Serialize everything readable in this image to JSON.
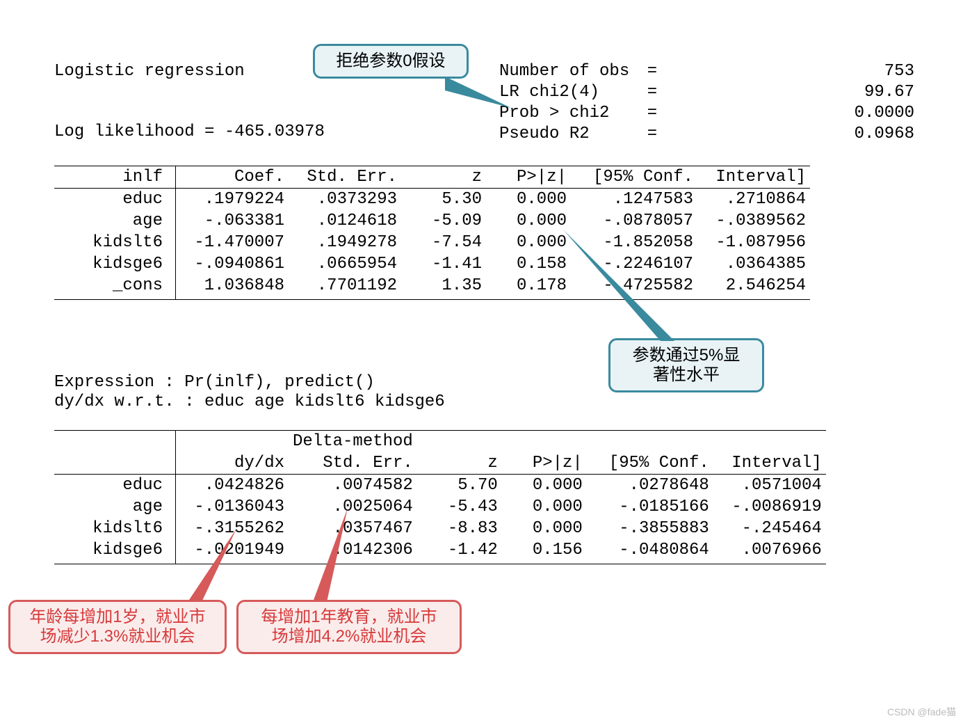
{
  "header": {
    "title": "Logistic regression",
    "loglik": "Log likelihood = -465.03978",
    "stats": [
      {
        "label": "Number of obs",
        "eq": "=",
        "val": "753"
      },
      {
        "label": "LR chi2(4)",
        "eq": "=",
        "val": "99.67"
      },
      {
        "label": "Prob > chi2",
        "eq": "=",
        "val": "0.0000"
      },
      {
        "label": "Pseudo R2",
        "eq": "=",
        "val": "0.0968"
      }
    ]
  },
  "table1": {
    "depvar": "inlf",
    "cols": [
      "Coef.",
      "Std. Err.",
      "z",
      "P>|z|",
      "[95% Conf.",
      "Interval]"
    ],
    "rows": [
      {
        "name": "educ",
        "coef": ".1979224",
        "se": ".0373293",
        "z": "5.30",
        "p": "0.000",
        "ci1": ".1247583",
        "ci2": ".2710864"
      },
      {
        "name": "age",
        "coef": "-.063381",
        "se": ".0124618",
        "z": "-5.09",
        "p": "0.000",
        "ci1": "-.0878057",
        "ci2": "-.0389562"
      },
      {
        "name": "kidslt6",
        "coef": "-1.470007",
        "se": ".1949278",
        "z": "-7.54",
        "p": "0.000",
        "ci1": "-1.852058",
        "ci2": "-1.087956"
      },
      {
        "name": "kidsge6",
        "coef": "-.0940861",
        "se": ".0665954",
        "z": "-1.41",
        "p": "0.158",
        "ci1": "-.2246107",
        "ci2": ".0364385"
      },
      {
        "name": "_cons",
        "coef": "1.036848",
        "se": ".7701192",
        "z": "1.35",
        "p": "0.178",
        "ci1": "-.4725582",
        "ci2": "2.546254"
      }
    ]
  },
  "expression": {
    "line1": "Expression   : Pr(inlf), predict()",
    "line2": "dy/dx w.r.t. : educ age kidslt6 kidsge6"
  },
  "table2": {
    "depvar": "",
    "delta": "Delta-method",
    "cols": [
      "dy/dx",
      "Std. Err.",
      "z",
      "P>|z|",
      "[95% Conf.",
      "Interval]"
    ],
    "rows": [
      {
        "name": "educ",
        "dydx": ".0424826",
        "se": ".0074582",
        "z": "5.70",
        "p": "0.000",
        "ci1": ".0278648",
        "ci2": ".0571004"
      },
      {
        "name": "age",
        "dydx": "-.0136043",
        "se": ".0025064",
        "z": "-5.43",
        "p": "0.000",
        "ci1": "-.0185166",
        "ci2": "-.0086919"
      },
      {
        "name": "kidslt6",
        "dydx": "-.3155262",
        "se": ".0357467",
        "z": "-8.83",
        "p": "0.000",
        "ci1": "-.3855883",
        "ci2": "-.245464"
      },
      {
        "name": "kidsge6",
        "dydx": "-.0201949",
        "se": ".0142306",
        "z": "-1.42",
        "p": "0.156",
        "ci1": "-.0480864",
        "ci2": ".0076966"
      }
    ]
  },
  "callouts": {
    "c1": "拒绝参数0假设",
    "c2": "参数通过5%显\n著性水平",
    "c3": "年龄每增加1岁，就业市\n场减少1.3%就业机会",
    "c4": "每增加1年教育，就业市\n场增加4.2%就业机会"
  },
  "watermark": "CSDN @fade猫"
}
